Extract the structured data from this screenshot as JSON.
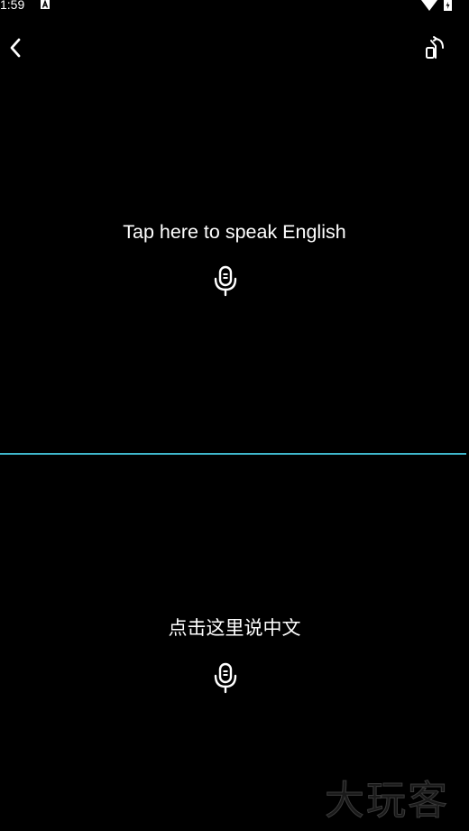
{
  "status_bar": {
    "time": "1:59",
    "icons": [
      "accessibility-a-icon",
      "wifi-icon",
      "battery-charging-icon"
    ]
  },
  "toolbar": {
    "back_icon": "chevron-left-icon",
    "rotate_icon": "rotate-screen-icon"
  },
  "top_panel": {
    "prompt": "Tap here to speak English",
    "icon": "microphone-icon"
  },
  "bottom_panel": {
    "prompt": "点击这里说中文",
    "icon": "microphone-icon"
  },
  "colors": {
    "background": "#000000",
    "text": "#ffffff",
    "divider": "#3fb7cc"
  },
  "watermark": {
    "text": "大玩客"
  }
}
